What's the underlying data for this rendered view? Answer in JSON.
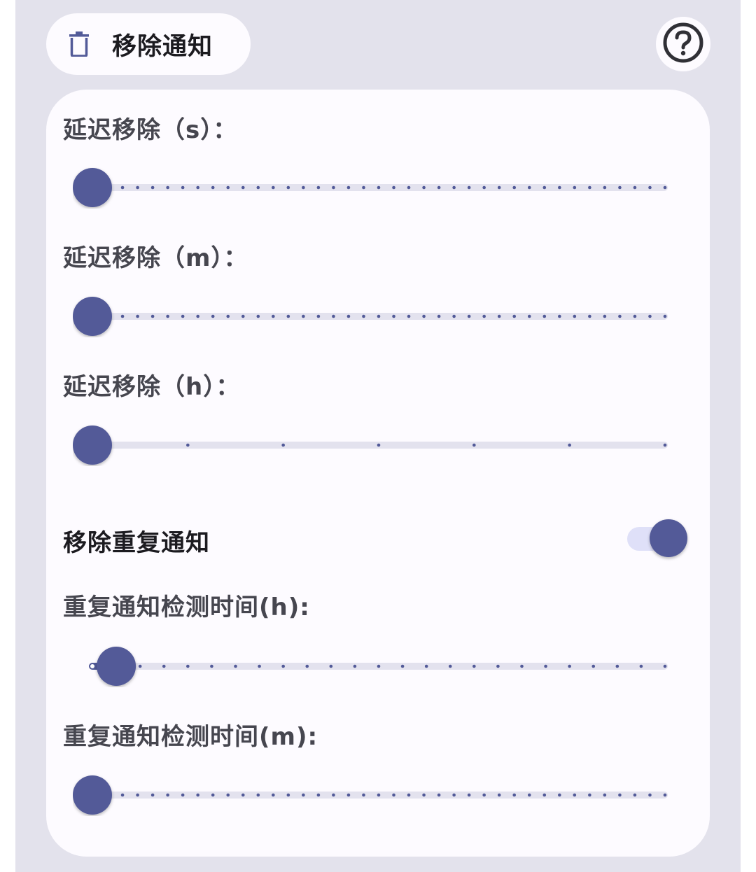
{
  "header": {
    "chip_label": "移除通知",
    "chip_icon": "trash-icon",
    "help_icon": "help-circle-icon"
  },
  "settings": {
    "delay_seconds": {
      "label": "延迟移除（s）：",
      "value": 0,
      "min": 0,
      "max": 60,
      "ticks": 39
    },
    "delay_minutes": {
      "label": "延迟移除（m）：",
      "value": 0,
      "min": 0,
      "max": 60,
      "ticks": 39
    },
    "delay_hours": {
      "label": "延迟移除（h）：",
      "value": 0,
      "min": 0,
      "max": 6,
      "ticks": 7
    },
    "remove_duplicate": {
      "label": "移除重复通知",
      "enabled": true
    },
    "duplicate_hours": {
      "label": "重复通知检测时间(h):",
      "value": 1,
      "min": 0,
      "max": 24,
      "ticks": 25
    },
    "duplicate_minutes": {
      "label": "重复通知检测时间(m):",
      "value": 0,
      "min": 0,
      "max": 60,
      "ticks": 39
    }
  },
  "colors": {
    "accent": "#525a98",
    "track": "#e3e2ee",
    "background": "#e3e2ec",
    "card": "#fdfbff",
    "switch_track": "#dfe0f8"
  }
}
